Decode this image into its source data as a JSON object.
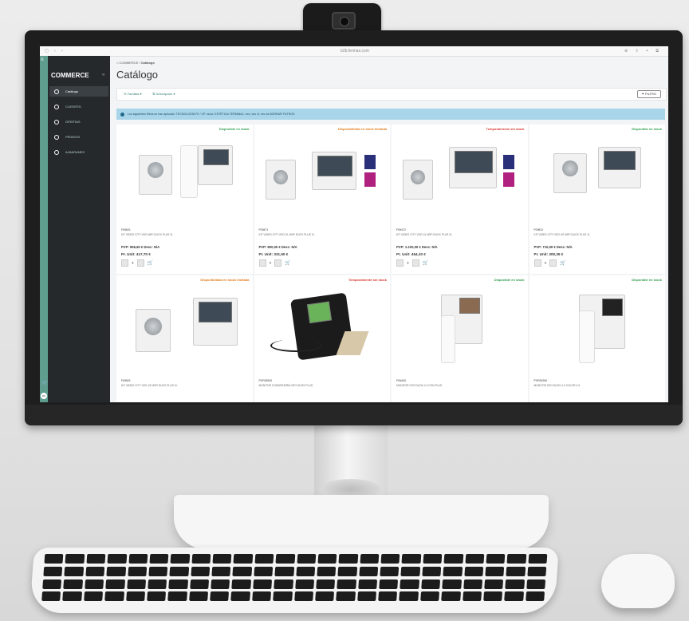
{
  "browser": {
    "url": "b2b.fermax.com"
  },
  "sidebar": {
    "brand": "COMMERCE",
    "items": [
      {
        "label": "Catálogo",
        "active": true
      },
      {
        "label": "CLIENTES"
      },
      {
        "label": "OFERTAS"
      },
      {
        "label": "PEDIDOS"
      },
      {
        "label": "ALBARANES"
      }
    ],
    "user_initials": "DS"
  },
  "breadcrumb": {
    "root": "COMMERCE",
    "current": "Catálogo"
  },
  "page_title": "Catálogo",
  "filters": {
    "families": "Familias",
    "description": "Descripción",
    "button": "FILTRO"
  },
  "alert": {
    "text": "Los siguientes filtros se han aplicado: TECNOLOGÍA FE / VP: duox; ESTÉTICA TERMINAL: veo; veo xl; veo xs  BORRAR FILTROS"
  },
  "colors": {
    "green": "#2e9e4a",
    "orange": "#e07a1a",
    "red": "#d8352a",
    "accent": "#5f9e8f"
  },
  "products": [
    {
      "stock": "Disponible en stock",
      "stock_color": "green",
      "ref": "F09621",
      "desc": "KIT VIDEO CITY VEO WIFI DUOX PLUS 2L",
      "pvp": "PVP: 956,60 € Desc: N/A",
      "unit": "Pr. Unit: 417,70 €"
    },
    {
      "stock": "Disponibilidad en stock limitada",
      "stock_color": "orange",
      "ref": "F09471",
      "desc": "KIT VIDEO CITY VEO-XL WIFI DUOX PLUS 1L",
      "pvp": "PVP: 800,00 € Desc: N/A",
      "unit": "Pr. Unit: 331,50 €"
    },
    {
      "stock": "Temporalmente sin stock",
      "stock_color": "red",
      "ref": "F09472",
      "desc": "KIT VIDEO CITY VEO-XL WIFI DUOX PLUS 2L",
      "pvp": "PVP: 1.220,00 € Desc: N/A",
      "unit": "Pr. Unit: 464,10 €"
    },
    {
      "stock": "Disponible en stock",
      "stock_color": "green",
      "ref": "F09511",
      "desc": "KIT VIDEO CITY VEO-XS WIFI DUOX PLUS 1L",
      "pvp": "PVP: 710,00 € Desc: N/A",
      "unit": "Pr. Unit: 300,35 €"
    },
    {
      "stock": "Disponibilidad en stock limitada",
      "stock_color": "orange",
      "ref": "F09521",
      "desc": "KIT VIDEO CITY VEO-XS WIFI DUOX PLUS 2L"
    },
    {
      "stock": "Temporalmente sin stock",
      "stock_color": "red",
      "ref": "PVF09520",
      "desc": "MONITOR CONSERJERÍA VEO DUOX PLUS"
    },
    {
      "stock": "Disponible en stock",
      "stock_color": "green",
      "ref": "F09403",
      "desc": "MONITOR VEO DUOX 4.3 CON PLUS"
    },
    {
      "stock": "Disponible en stock",
      "stock_color": "green",
      "ref": "PVF09290",
      "desc": "MONITOR VEO DUOX 4.3 COLOR 4.3"
    }
  ]
}
